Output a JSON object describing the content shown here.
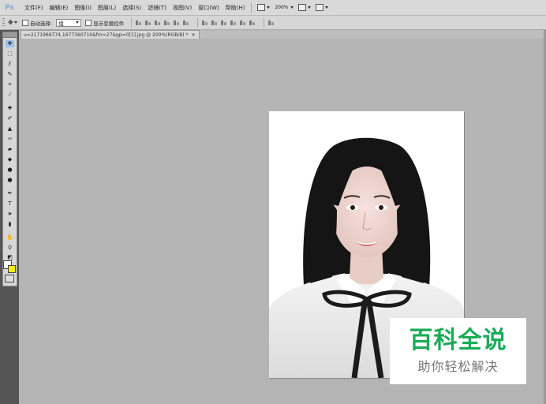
{
  "menu": {
    "logo": "Ps",
    "items": [
      "文件(F)",
      "编辑(E)",
      "图像(I)",
      "图层(L)",
      "选择(S)",
      "滤镜(T)",
      "视图(V)",
      "窗口(W)",
      "帮助(H)"
    ],
    "zoom": "200%"
  },
  "options": {
    "auto_select_label": "自动选择:",
    "auto_select_value": "组",
    "show_transform_label": "显示变换控件"
  },
  "document": {
    "tab_title": "u=2171969774,1677360710&fm=27&gp=0[1].jpg @ 200%(RGB/8) *",
    "close_symbol": "✕"
  },
  "colors": {
    "foreground": "#ffffff",
    "background": "#ffee00",
    "watermark_green": "#1aab57"
  },
  "watermark": {
    "title": "百科全说",
    "subtitle": "助你轻松解决"
  }
}
